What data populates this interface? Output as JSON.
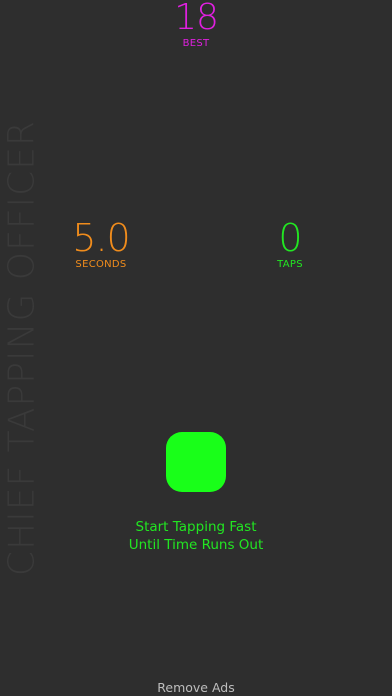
{
  "colors": {
    "background": "#2e2e2e",
    "best": "#e020e0",
    "seconds": "#f08c1c",
    "taps": "#22e622",
    "button": "#19ff19",
    "instructions": "#22e622",
    "watermark": "#3a3a3a",
    "remove_ads": "#bdbdbd"
  },
  "best": {
    "value": "18",
    "label": "BEST"
  },
  "watermark": "CHIEF TAPPING OFFICER",
  "stats": {
    "seconds": {
      "value": "5.0",
      "label": "SECONDS"
    },
    "taps": {
      "value": "0",
      "label": "TAPS"
    }
  },
  "tap_button": {
    "icon": "rounded-square-button"
  },
  "instructions": {
    "line1": "Start Tapping Fast",
    "line2": "Until Time Runs Out"
  },
  "remove_ads": "Remove Ads"
}
